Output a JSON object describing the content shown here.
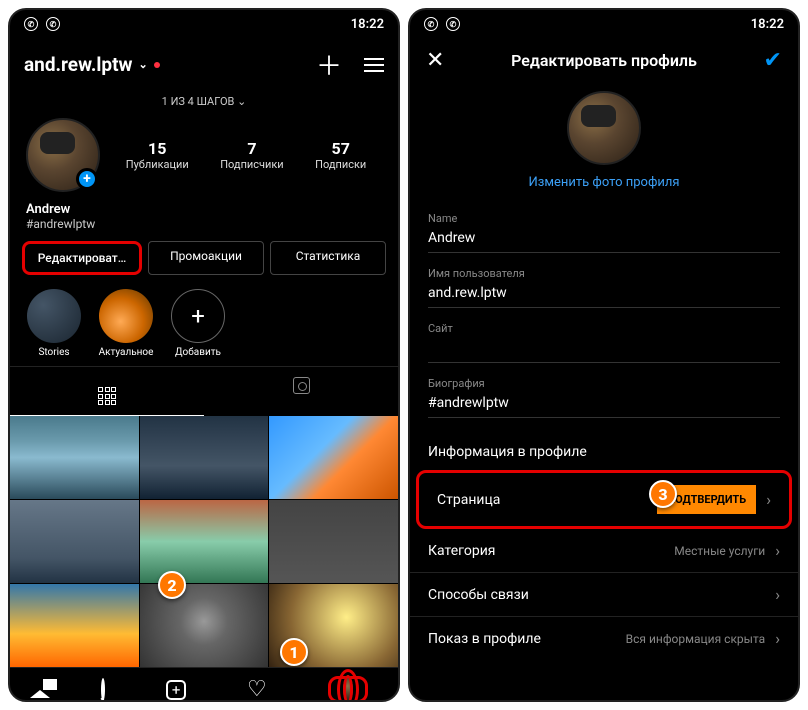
{
  "statusbar": {
    "time": "18:22"
  },
  "left": {
    "username": "and.rew.lptw",
    "steps": "1 ИЗ 4 ШАГОВ",
    "stats": {
      "posts_n": "15",
      "posts_l": "Публикации",
      "followers_n": "7",
      "followers_l": "Подписчики",
      "following_n": "57",
      "following_l": "Подписки"
    },
    "display_name": "Andrew",
    "bio": "#andrewlptw",
    "buttons": {
      "edit": "Редактироват…",
      "promo": "Промоакции",
      "stats": "Статистика"
    },
    "highlights": {
      "stories": "Stories",
      "actual": "Актуальное",
      "add": "Добавить"
    }
  },
  "right": {
    "title": "Редактировать профиль",
    "change_photo": "Изменить фото профиля",
    "fields": {
      "name_l": "Name",
      "name_v": "Andrew",
      "user_l": "Имя пользователя",
      "user_v": "and.rew.lptw",
      "site_l": "Сайт",
      "site_v": "",
      "bio_l": "Биография",
      "bio_v": "#andrewlptw"
    },
    "section": "Информация в профиле",
    "items": {
      "page_l": "Страница",
      "page_btn": "ПОДТВЕРДИТЬ",
      "cat_l": "Категория",
      "cat_v": "Местные услуги",
      "contact_l": "Способы связи",
      "display_l": "Показ в профиле",
      "display_v": "Вся информация скрыта"
    }
  },
  "markers": {
    "m1": "1",
    "m2": "2",
    "m3": "3"
  }
}
